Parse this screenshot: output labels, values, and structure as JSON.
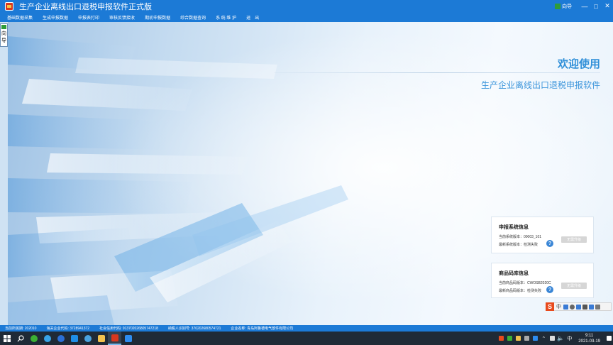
{
  "window": {
    "title": "生产企业离线出口退税申报软件正式版",
    "guide_label": "向导",
    "controls": [
      "—",
      "□",
      "✕"
    ]
  },
  "menu": {
    "items": [
      "基础数据采集",
      "生成申报数据",
      "申报表打印",
      "审核反馈接收",
      "期初申报数据",
      "综合数据查询",
      "系 统 维 护",
      "退　出"
    ]
  },
  "guide_tab": {
    "chars": [
      "向",
      "导"
    ]
  },
  "welcome": {
    "title": "欢迎使用",
    "subtitle": "生产企业离线出口退税申报软件"
  },
  "system_info": {
    "title": "申报系统信息",
    "current_label": "当前系统版本：00003_101",
    "latest_label": "最新系统版本：检测失败",
    "button": "无需升级"
  },
  "code_info": {
    "title": "商品码库信息",
    "current_label": "当前商品码版本：CWOSB2020C",
    "latest_label": "最新商品码版本：检测失败",
    "button": "无需升级"
  },
  "ime": {
    "logo": "S",
    "lang": "中"
  },
  "statusbar": {
    "items": [
      "当前所属期: 202010",
      "海关企业代码: 3728941372",
      "社会信用代码: 913702026805747218",
      "纳税人识别号: 370202680574721",
      "企业名称: 青岛阿鲁德电气部件有限公司"
    ]
  },
  "taskbar": {
    "lang": "中",
    "time": "9:11",
    "date": "2021-03-19"
  },
  "colors": {
    "accent": "#1c7ad6",
    "welcome": "#2f8fd8",
    "taskbar": "#1f2a36"
  }
}
